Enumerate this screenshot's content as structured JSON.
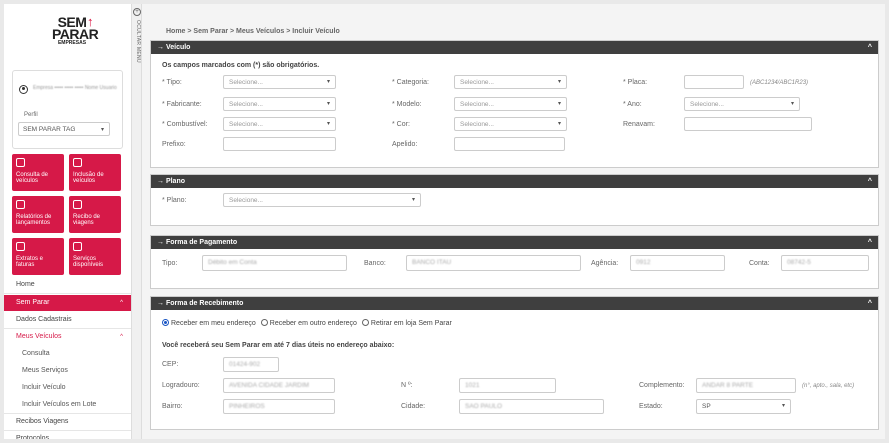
{
  "logo": {
    "line1": "SEM",
    "line2": "PARAR",
    "line3": "EMPRESAS"
  },
  "user": {
    "name": "Empresa ••••• ••••• ••••• Nome Usuario",
    "perfil_label": "Perfil",
    "perfil_value": "SEM PARAR TAG"
  },
  "tiles": [
    {
      "label": "Consulta de veículos"
    },
    {
      "label": "Inclusão de veículos"
    },
    {
      "label": "Relatórios de lançamentos"
    },
    {
      "label": "Recibo de viagens"
    },
    {
      "label": "Extratos e faturas"
    },
    {
      "label": "Serviços disponíveis"
    }
  ],
  "menu": {
    "home": "Home",
    "sem_parar": "Sem Parar",
    "dados": "Dados Cadastrais",
    "meus_veiculos": "Meus Veículos",
    "consulta": "Consulta",
    "meus_servicos": "Meus Serviços",
    "incluir": "Incluir Veículo",
    "incluir_lote": "Incluir Veículos em Lote",
    "recibos": "Recibos Viagens",
    "protocolos": "Protocolos"
  },
  "strip": {
    "icon": "+",
    "text": "OCULTAR MENU"
  },
  "breadcrumb": "Home > Sem Parar > Meus Veículos > Incluir Veículo",
  "veiculo": {
    "title": "→ Veículo",
    "obrigatorios": "Os campos marcados com (*) são obrigatórios.",
    "tipo_label": "* Tipo:",
    "tipo_value": "Selecione...",
    "categoria_label": "* Categoria:",
    "categoria_value": "Selecione...",
    "placa_label": "* Placa:",
    "placa_hint": "(ABC1234/ABC1R23)",
    "fabricante_label": "* Fabricante:",
    "fabricante_value": "Selecione...",
    "modelo_label": "* Modelo:",
    "modelo_value": "Selecione...",
    "ano_label": "* Ano:",
    "ano_value": "Selecione...",
    "combustivel_label": "* Combustível:",
    "combustivel_value": "Selecione...",
    "cor_label": "* Cor:",
    "cor_value": "Selecione...",
    "renavam_label": "Renavam:",
    "prefixo_label": "Prefixo:",
    "apelido_label": "Apelido:"
  },
  "plano": {
    "title": "→ Plano",
    "label": "* Plano:",
    "value": "Selecione..."
  },
  "pagamento": {
    "title": "→ Forma de Pagamento",
    "tipo_label": "Tipo:",
    "tipo_value": "Débito em Conta",
    "banco_label": "Banco:",
    "banco_value": "BANCO ITAU",
    "agencia_label": "Agência:",
    "agencia_value": "0912",
    "conta_label": "Conta:",
    "conta_value": "08742-5"
  },
  "recebimento": {
    "title": "→ Forma de Recebimento",
    "opt1": "Receber em meu endereço",
    "opt2": "Receber em outro endereço",
    "opt3": "Retirar em loja Sem Parar",
    "aviso": "Você receberá seu Sem Parar em até 7 dias úteis no endereço abaixo:",
    "cep_label": "CEP:",
    "cep_value": "01424-902",
    "logradouro_label": "Logradouro:",
    "logradouro_value": "AVENIDA CIDADE JARDIM",
    "numero_label": "N º:",
    "numero_value": "1021",
    "complemento_label": "Complemento:",
    "complemento_value": "ANDAR 8 PARTE",
    "complemento_hint": "(n°, apto., sala, etc)",
    "bairro_label": "Bairro:",
    "bairro_value": "PINHEIROS",
    "cidade_label": "Cidade:",
    "cidade_value": "SAO PAULO",
    "estado_label": "Estado:",
    "estado_value": "SP"
  },
  "icons": {
    "collapse": "^",
    "caret": "▾"
  },
  "colors": {
    "brand": "#d61948",
    "panel_header": "#3f3f3f",
    "radio": "#1a56c4"
  }
}
